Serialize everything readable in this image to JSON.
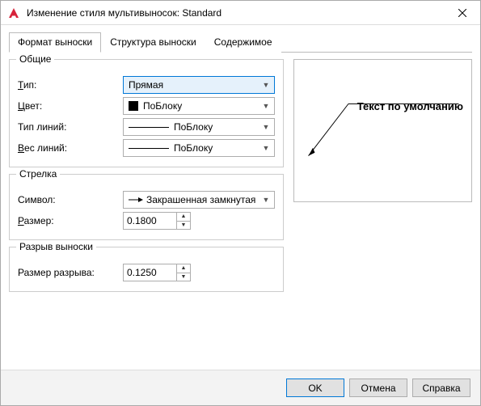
{
  "window": {
    "title": "Изменение стиля мультивыносок: Standard"
  },
  "tabs": {
    "format": "Формат выноски",
    "structure": "Структура выноски",
    "content": "Содержимое"
  },
  "groups": {
    "general": {
      "legend": "Общие",
      "type_label": "Тип:",
      "type_value": "Прямая",
      "color_label": "Цвет:",
      "color_value": "ПоБлоку",
      "linetype_label": "Тип линий:",
      "linetype_value": "ПоБлоку",
      "lineweight_label": "Вес линий:",
      "lineweight_value": "ПоБлоку"
    },
    "arrow": {
      "legend": "Стрелка",
      "symbol_label": "Символ:",
      "symbol_value": "Закрашенная замкнутая",
      "size_label": "Размер:",
      "size_value": "0.1800"
    },
    "break": {
      "legend": "Разрыв выноски",
      "size_label": "Размер разрыва:",
      "size_value": "0.1250"
    }
  },
  "preview": {
    "text": "Текст по умолчанию"
  },
  "buttons": {
    "ok": "OK",
    "cancel": "Отмена",
    "help": "Справка"
  }
}
